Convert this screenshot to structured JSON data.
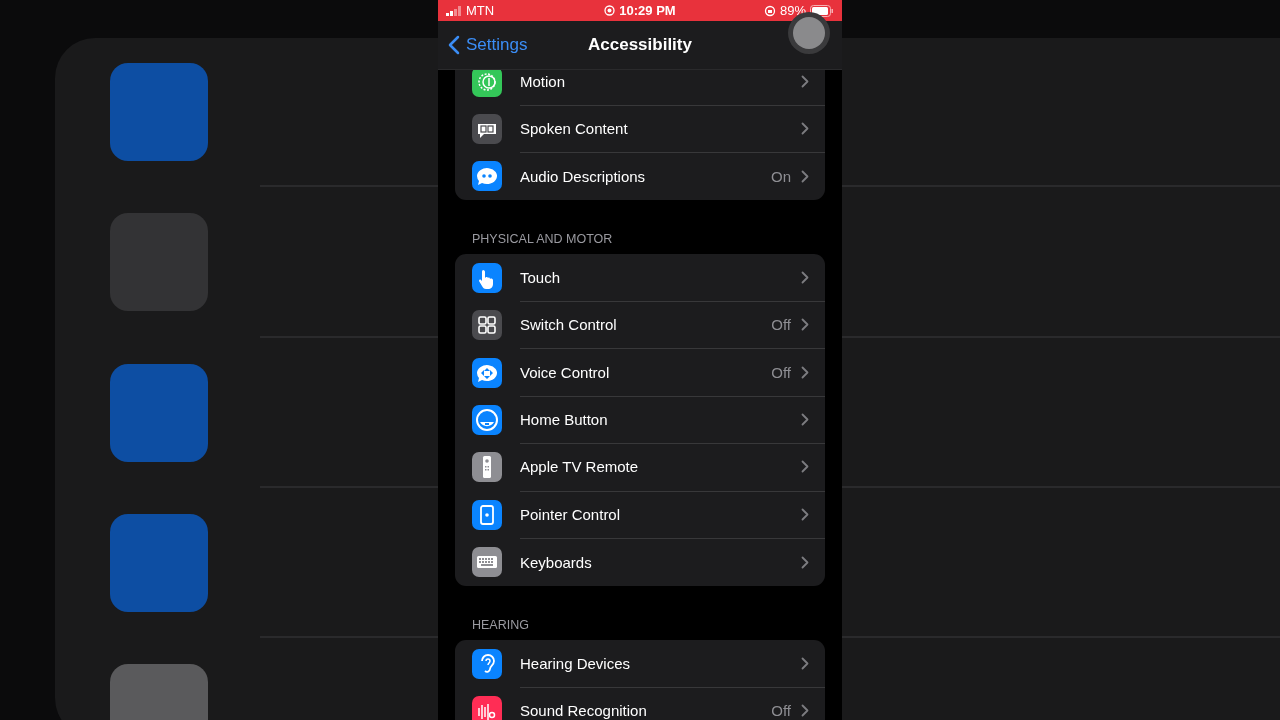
{
  "status_bar": {
    "carrier": "MTN",
    "time": "10:29 PM",
    "battery": "89%"
  },
  "nav": {
    "back": "Settings",
    "title": "Accessibility"
  },
  "sections": [
    {
      "items": [
        {
          "label": "Motion",
          "color": "#34c759"
        },
        {
          "label": "Spoken Content",
          "color": "#4a4a4e"
        },
        {
          "label": "Audio Descriptions",
          "value": "On",
          "color": "#0a84ff"
        }
      ]
    },
    {
      "header": "PHYSICAL AND MOTOR",
      "items": [
        {
          "label": "Touch",
          "color": "#0a84ff"
        },
        {
          "label": "Switch Control",
          "value": "Off",
          "color": "#4a4a4e"
        },
        {
          "label": "Voice Control",
          "value": "Off",
          "color": "#0a84ff"
        },
        {
          "label": "Home Button",
          "color": "#0a84ff"
        },
        {
          "label": "Apple TV Remote",
          "color": "#8e8e93"
        },
        {
          "label": "Pointer Control",
          "color": "#0a84ff"
        },
        {
          "label": "Keyboards",
          "color": "#8e8e93"
        }
      ]
    },
    {
      "header": "HEARING",
      "items": [
        {
          "label": "Hearing Devices",
          "color": "#0a84ff"
        },
        {
          "label": "Sound Recognition",
          "value": "Off",
          "color": "#ff2d55"
        }
      ]
    }
  ]
}
